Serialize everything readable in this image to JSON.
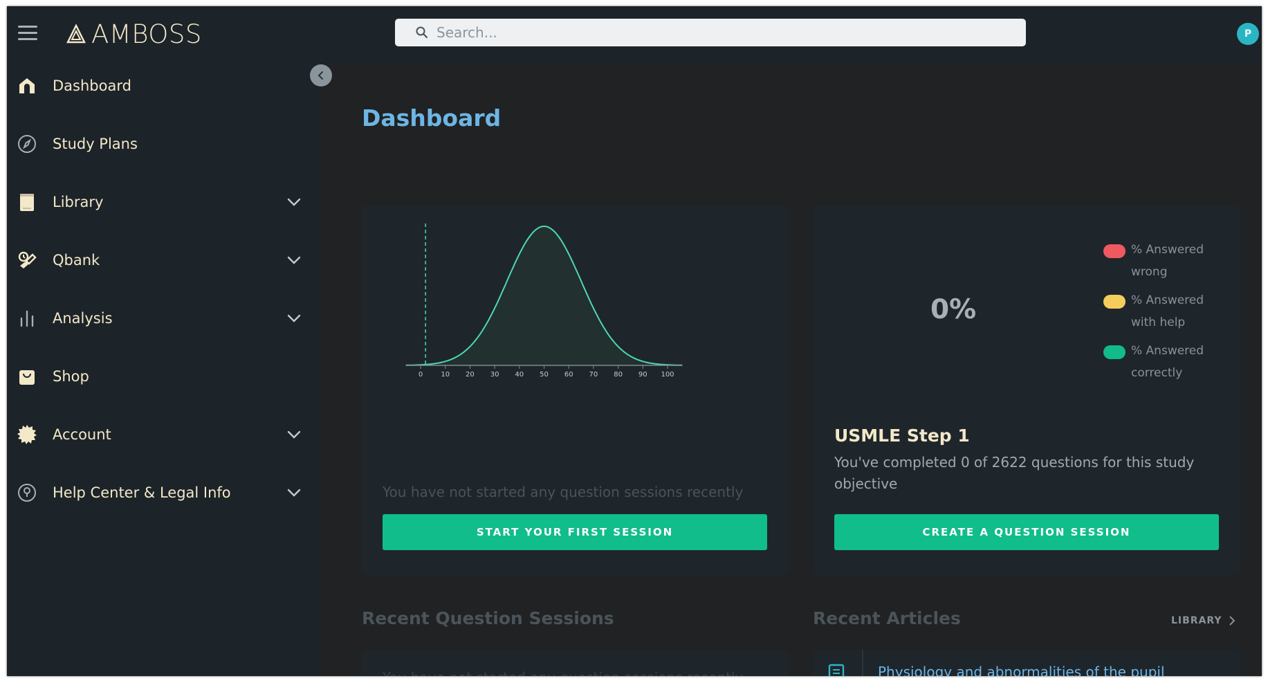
{
  "app": {
    "logo_text": "AMBOSS",
    "avatar_initial": "P"
  },
  "search": {
    "placeholder": "Search..."
  },
  "sidebar": {
    "items": [
      {
        "label": "Dashboard",
        "icon": "home-icon",
        "has_chevron": false
      },
      {
        "label": "Study Plans",
        "icon": "compass-icon",
        "has_chevron": false
      },
      {
        "label": "Library",
        "icon": "book-icon",
        "has_chevron": true
      },
      {
        "label": "Qbank",
        "icon": "qbank-icon",
        "has_chevron": true
      },
      {
        "label": "Analysis",
        "icon": "bar-chart-icon",
        "has_chevron": true
      },
      {
        "label": "Shop",
        "icon": "shopping-bag-icon",
        "has_chevron": false
      },
      {
        "label": "Account",
        "icon": "gear-icon",
        "has_chevron": true
      },
      {
        "label": "Help Center & Legal Info",
        "icon": "help-icon",
        "has_chevron": true
      }
    ]
  },
  "main": {
    "title": "Dashboard",
    "sessions_card": {
      "empty_text": "You have not started any question sessions recently",
      "button_label": "START YOUR FIRST SESSION"
    },
    "study_card": {
      "percent": "0%",
      "legend": [
        {
          "label": "% Answered wrong",
          "color": "#ee5a5f"
        },
        {
          "label": "% Answered with help",
          "color": "#f5cd5c"
        },
        {
          "label": "% Answered correctly",
          "color": "#12bb8a"
        }
      ],
      "title": "USMLE Step 1",
      "description": "You've completed 0 of 2622 questions for this study objective",
      "button_label": "CREATE A QUESTION SESSION"
    },
    "recent_sessions": {
      "title": "Recent Question Sessions",
      "faded_text": "You have not started any question sessions recently"
    },
    "recent_articles": {
      "title": "Recent Articles",
      "library_link": "LIBRARY",
      "items": [
        {
          "title": "Physiology and abnormalities of the pupil"
        }
      ]
    }
  },
  "chart_data": {
    "type": "area",
    "title": "",
    "xlabel": "",
    "ylabel": "",
    "x_ticks": [
      0,
      10,
      20,
      30,
      40,
      50,
      60,
      70,
      80,
      90,
      100
    ],
    "xlim": [
      0,
      100
    ],
    "distribution": {
      "shape": "normal",
      "mean": 50,
      "sd": 15
    },
    "marker_x": 2,
    "colors": {
      "curve": "#4fd8b4",
      "fill": "#22302f",
      "axis": "#7d8a8f"
    }
  }
}
